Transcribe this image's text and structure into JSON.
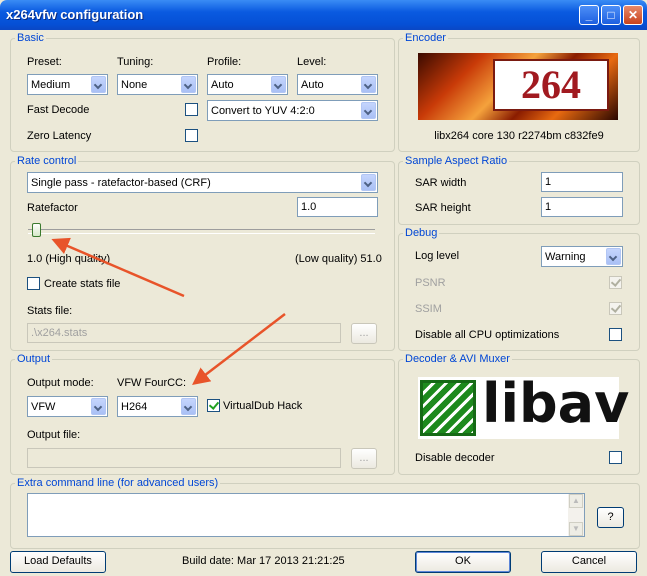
{
  "window": {
    "title": "x264vfw configuration"
  },
  "colors": {
    "group_label": "#0046d5",
    "titlebar": "#0a5ae0",
    "annotation_arrow": "#e8542a"
  },
  "basic": {
    "label": "Basic",
    "preset": {
      "label": "Preset:",
      "value": "Medium"
    },
    "tuning": {
      "label": "Tuning:",
      "value": "None"
    },
    "profile": {
      "label": "Profile:",
      "value": "Auto"
    },
    "level": {
      "label": "Level:",
      "value": "Auto"
    },
    "fast_decode": {
      "label": "Fast Decode",
      "checked": false
    },
    "zero_latency": {
      "label": "Zero Latency",
      "checked": false
    },
    "colorspace": {
      "value": "Convert to YUV 4:2:0"
    }
  },
  "encoder": {
    "label": "Encoder",
    "logo_text": "264",
    "version": "libx264 core 130 r2274bm c832fe9"
  },
  "rate_control": {
    "label": "Rate control",
    "mode": "Single pass - ratefactor-based (CRF)",
    "ratefactor_label": "Ratefactor",
    "ratefactor_value": "1.0",
    "slider_fraction": 0.0,
    "min_label": "1.0 (High quality)",
    "max_label": "(Low quality) 51.0",
    "create_stats": {
      "label": "Create stats file",
      "checked": false
    },
    "stats_label": "Stats file:",
    "stats_value": ".\\x264.stats",
    "browse": "..."
  },
  "sar": {
    "label": "Sample Aspect Ratio",
    "width_label": "SAR width",
    "width_value": "1",
    "height_label": "SAR height",
    "height_value": "1"
  },
  "debug": {
    "label": "Debug",
    "log_level_label": "Log level",
    "log_level_value": "Warning",
    "psnr": {
      "label": "PSNR",
      "checked": true
    },
    "ssim": {
      "label": "SSIM",
      "checked": true
    },
    "disable_cpu": {
      "label": "Disable all CPU optimizations",
      "checked": false
    }
  },
  "output": {
    "label": "Output",
    "mode_label": "Output mode:",
    "mode_value": "VFW",
    "fourcc_label": "VFW FourCC:",
    "fourcc_value": "H264",
    "vdub_hack": {
      "label": "VirtualDub Hack",
      "checked": true
    },
    "file_label": "Output file:",
    "browse": "..."
  },
  "decoder": {
    "label": "Decoder & AVI Muxer",
    "logo_text": "libav",
    "disable_decoder": {
      "label": "Disable decoder",
      "checked": false
    }
  },
  "extra": {
    "label": "Extra command line (for advanced users)",
    "help": "?"
  },
  "footer": {
    "load_defaults": "Load Defaults",
    "build_date": "Build date: Mar 17 2013 21:21:25",
    "ok": "OK",
    "cancel": "Cancel"
  }
}
